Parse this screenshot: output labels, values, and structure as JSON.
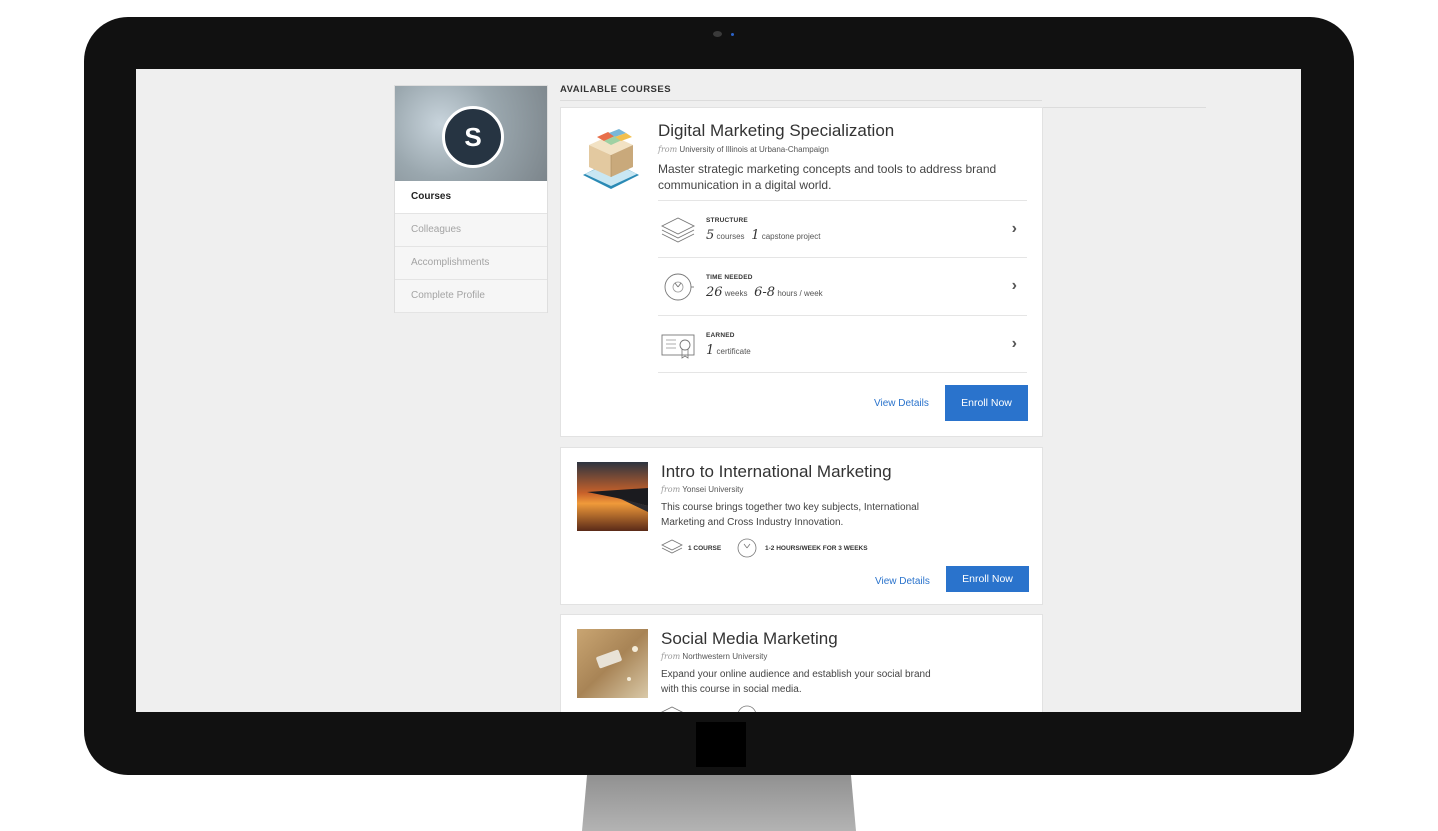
{
  "profile": {
    "avatar_letter": "S",
    "nav": [
      "Courses",
      "Colleagues",
      "Accomplishments",
      "Complete Profile"
    ]
  },
  "section_title": "AVAILABLE COURSES",
  "courses": [
    {
      "title": "Digital Marketing Specialization",
      "from_prefix": "from",
      "institution": "University of Illinois at Urbana-Champaign",
      "description": "Master strategic marketing concepts and tools to address brand communication in a digital world.",
      "structure": {
        "label": "STRUCTURE",
        "n1": "5",
        "u1": "courses",
        "n2": "1",
        "u2": "capstone project"
      },
      "time": {
        "label": "TIME NEEDED",
        "n1": "26",
        "u1": "weeks",
        "n2": "6-8",
        "u2": "hours / week"
      },
      "earned": {
        "label": "EARNED",
        "n1": "1",
        "u1": "certificate"
      },
      "view_details": "View Details",
      "enroll": "Enroll Now"
    },
    {
      "title": "Intro to International Marketing",
      "from_prefix": "from",
      "institution": "Yonsei University",
      "description": "This course brings together two key subjects, International Marketing and Cross Industry Innovation.",
      "meta_course": "1 COURSE",
      "meta_time": "1-2 HOURS/WEEK FOR 3 WEEKS",
      "view_details": "View Details",
      "enroll": "Enroll Now"
    },
    {
      "title": "Social Media Marketing",
      "from_prefix": "from",
      "institution": "Northwestern University",
      "description": "Expand your online audience and establish your social brand with this course in social media."
    }
  ],
  "colors": {
    "accent": "#2a73cc",
    "avatar_bg": "#263442",
    "screen_bg": "#efefef",
    "bezel": "#111111"
  }
}
